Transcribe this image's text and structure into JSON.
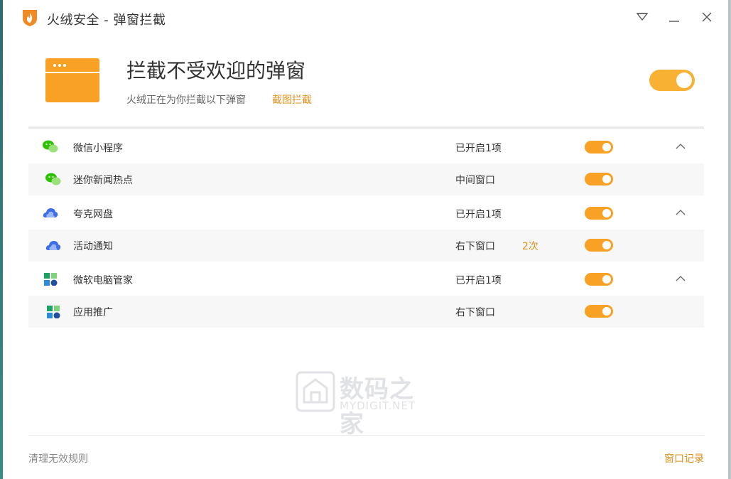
{
  "window": {
    "title": "火绒安全 - 弹窗拦截",
    "controls": [
      "menu-icon",
      "minimize-icon",
      "close-icon"
    ]
  },
  "hero": {
    "title": "拦截不受欢迎的弹窗",
    "subtitle": "火绒正在为你拦截以下弹窗",
    "link": "截图拦截",
    "enabled": true
  },
  "rules": [
    {
      "name": "微信小程序",
      "status": "已开启1项",
      "count": "",
      "icon": "wechat-icon",
      "type": "group",
      "enabled": true,
      "expanded": true
    },
    {
      "name": "迷你新闻热点",
      "status": "中间窗口",
      "count": "",
      "icon": "wechat-icon",
      "type": "item",
      "enabled": true
    },
    {
      "name": "夸克网盘",
      "status": "已开启1项",
      "count": "",
      "icon": "quark-cloud-icon",
      "type": "group",
      "enabled": true,
      "expanded": true
    },
    {
      "name": "活动通知",
      "status": "右下窗口",
      "count": "2次",
      "icon": "quark-cloud-icon",
      "type": "item",
      "enabled": true
    },
    {
      "name": "微软电脑管家",
      "status": "已开启1项",
      "count": "",
      "icon": "ms-pc-manager-icon",
      "type": "group",
      "enabled": true,
      "expanded": true
    },
    {
      "name": "应用推广",
      "status": "右下窗口",
      "count": "",
      "icon": "ms-pc-manager-icon",
      "type": "item",
      "enabled": true
    }
  ],
  "watermark": {
    "cn": "数码之家",
    "en": "MYDIGIT.NET"
  },
  "footer": {
    "left": "清理无效规则",
    "right": "窗口记录"
  },
  "colors": {
    "accent": "#f8a125",
    "link": "#e0901c",
    "wechat": "#2dc100",
    "quark": "#3d6ee8",
    "ms": "#1aa260"
  }
}
